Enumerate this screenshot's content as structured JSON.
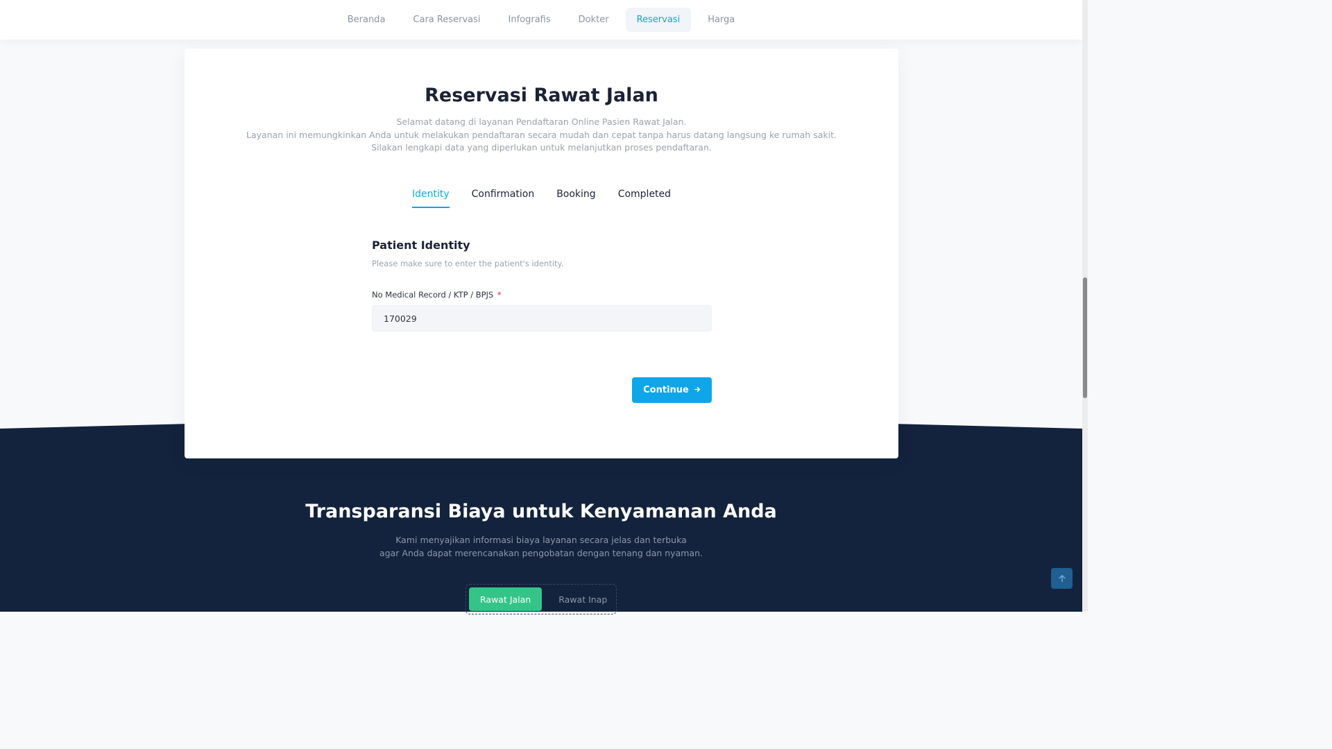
{
  "nav": {
    "items": [
      {
        "label": "Beranda"
      },
      {
        "label": "Cara Reservasi"
      },
      {
        "label": "Infografis"
      },
      {
        "label": "Dokter"
      },
      {
        "label": "Reservasi"
      },
      {
        "label": "Harga"
      }
    ],
    "active": "Reservasi"
  },
  "card": {
    "title": "Reservasi Rawat Jalan",
    "description": [
      "Selamat datang di layanan Pendaftaran Online Pasien Rawat Jalan.",
      "Layanan ini memungkinkan Anda untuk melakukan pendaftaran secara mudah dan cepat tanpa harus datang langsung ke rumah sakit.",
      "Silakan lengkapi data yang diperlukan untuk melanjutkan proses pendaftaran."
    ],
    "steps": [
      {
        "label": "Identity"
      },
      {
        "label": "Confirmation"
      },
      {
        "label": "Booking"
      },
      {
        "label": "Completed"
      }
    ],
    "active_step": "Identity",
    "form": {
      "title": "Patient Identity",
      "subtitle": "Please make sure to enter the patient's identity.",
      "field_label": "No Medical Record / KTP / BPJS",
      "required_mark": "*",
      "field_value": "170029"
    },
    "continue_label": "Continue"
  },
  "pricing": {
    "title": "Transparansi Biaya untuk Kenyamanan Anda",
    "description": [
      "Kami menyajikan informasi biaya layanan secara jelas dan terbuka",
      "agar Anda dapat merencanakan pengobatan dengan tenang dan nyaman."
    ],
    "tabs": [
      {
        "label": "Rawat Jalan"
      },
      {
        "label": "Rawat Inap"
      }
    ],
    "active_tab": "Rawat Jalan"
  },
  "colors": {
    "accent": "#0ea5e9",
    "dark_bg": "#13233d",
    "green": "#34c487"
  },
  "icons": {
    "continue": "arrow-right-icon",
    "back_to_top": "arrow-up-icon"
  }
}
